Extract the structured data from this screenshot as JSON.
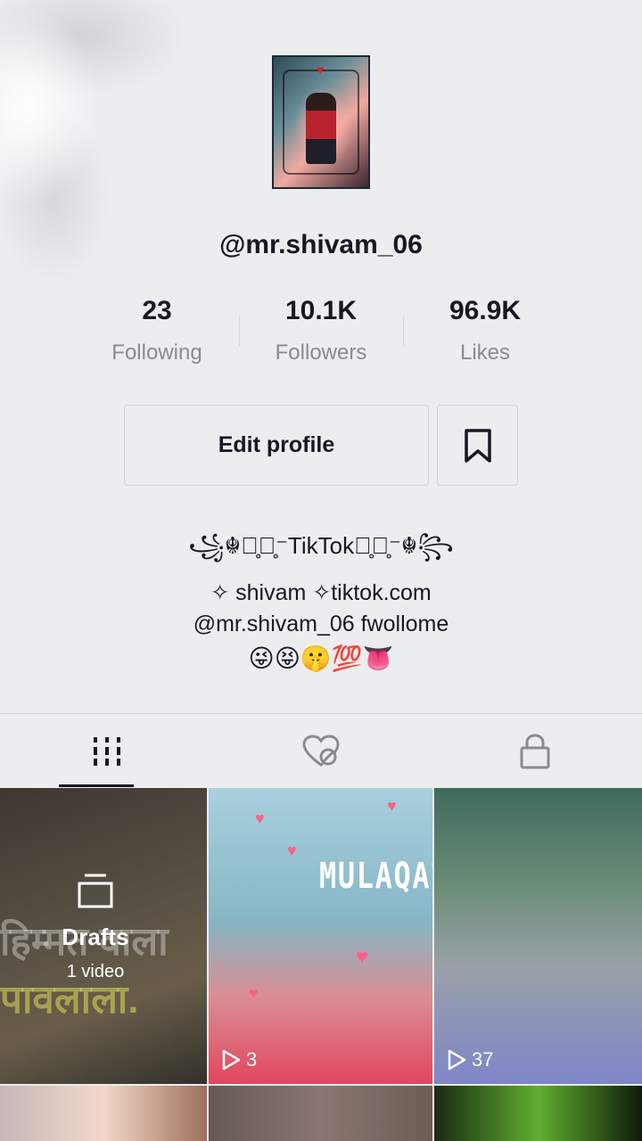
{
  "profile": {
    "username": "@mr.shivam_06"
  },
  "stats": [
    {
      "value": "23",
      "label": "Following"
    },
    {
      "value": "10.1K",
      "label": "Followers"
    },
    {
      "value": "96.9K",
      "label": "Likes"
    }
  ],
  "actions": {
    "edit_profile": "Edit profile"
  },
  "bio": {
    "line1": "꧁☬⁻̥⃝̥⁻TikTok⁻̥⃝̥⁻☬꧂",
    "line2": "✧ shivam ✧tiktok.com",
    "line3": "@mr.shivam_06 fwollome",
    "line4": "😜😝🤫💯👅"
  },
  "tabs": [
    {
      "icon": "grid-icon",
      "active": true
    },
    {
      "icon": "liked-hidden-icon",
      "active": false
    },
    {
      "icon": "lock-icon",
      "active": false
    }
  ],
  "videos": {
    "drafts_label": "Drafts",
    "drafts_count": "1 video",
    "cell1_text_a": "हिम्मत वाला",
    "cell1_text_b": "पावलाला.",
    "cell2_overlay": "MULAQAT M",
    "cell2_plays": "3",
    "cell3_plays": "37"
  },
  "colors": {
    "background": "#ecedef",
    "text_primary": "#161823",
    "text_secondary": "#8a8b91",
    "border": "#d2d3d6"
  }
}
